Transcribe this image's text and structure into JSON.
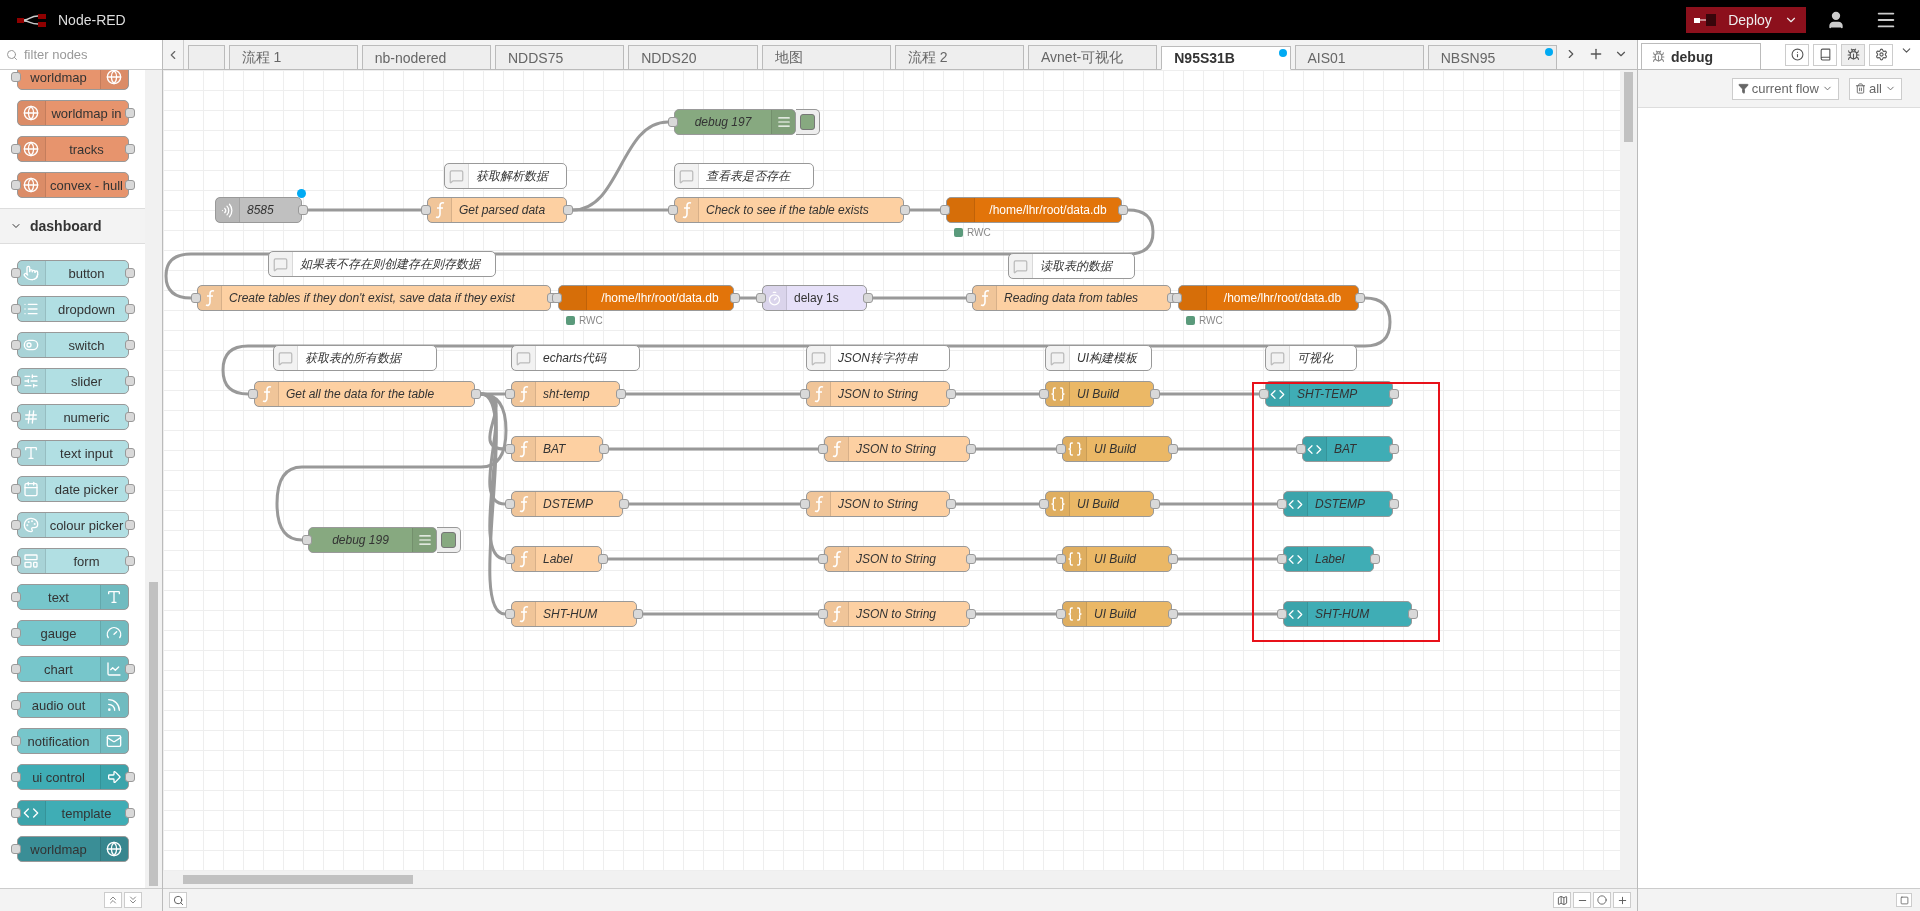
{
  "header": {
    "title": "Node-RED",
    "deploy": "Deploy"
  },
  "palette": {
    "filter_placeholder": "filter nodes",
    "nodes": [
      {
        "label": "worldmap",
        "kind": "output",
        "color": "#e7946d"
      },
      {
        "label": "worldmap in",
        "kind": "input",
        "color": "#e7946d"
      },
      {
        "label": "tracks",
        "kind": "function",
        "color": "#e7946d"
      },
      {
        "label": "convex - hull",
        "kind": "function",
        "color": "#e7946d"
      }
    ],
    "category": {
      "label": "dashboard",
      "expanded": true
    },
    "dashboard_nodes": [
      {
        "label": "button",
        "kind": "function",
        "color": "#b1dfe3"
      },
      {
        "label": "dropdown",
        "kind": "function",
        "color": "#b1dfe3"
      },
      {
        "label": "switch",
        "kind": "function",
        "color": "#b1dfe3"
      },
      {
        "label": "slider",
        "kind": "function",
        "color": "#b1dfe3"
      },
      {
        "label": "numeric",
        "kind": "function",
        "color": "#b1dfe3"
      },
      {
        "label": "text input",
        "kind": "function",
        "color": "#b1dfe3"
      },
      {
        "label": "date picker",
        "kind": "function",
        "color": "#b1dfe3"
      },
      {
        "label": "colour picker",
        "kind": "function",
        "color": "#b1dfe3"
      },
      {
        "label": "form",
        "kind": "function",
        "color": "#b1dfe3"
      },
      {
        "label": "text",
        "kind": "output",
        "color": "#77c6cb"
      },
      {
        "label": "gauge",
        "kind": "output",
        "color": "#77c6cb"
      },
      {
        "label": "chart",
        "kind": "through",
        "color": "#77c6cb"
      },
      {
        "label": "audio out",
        "kind": "output",
        "color": "#77c6cb"
      },
      {
        "label": "notification",
        "kind": "output",
        "color": "#77c6cb"
      },
      {
        "label": "ui control",
        "kind": "through",
        "color": "#3fadb5"
      },
      {
        "label": "template",
        "kind": "function",
        "color": "#3fadb5"
      },
      {
        "label": "worldmap",
        "kind": "output",
        "color": "#3a8e96"
      }
    ]
  },
  "tabs": [
    {
      "label": "流程 1",
      "selected": false,
      "changed": false
    },
    {
      "label": "nb-nodered",
      "selected": false,
      "changed": false
    },
    {
      "label": "NDDS75",
      "selected": false,
      "changed": false
    },
    {
      "label": "NDDS20",
      "selected": false,
      "changed": false
    },
    {
      "label": "地图",
      "selected": false,
      "changed": false
    },
    {
      "label": "流程 2",
      "selected": false,
      "changed": false
    },
    {
      "label": "Avnet-可视化",
      "selected": false,
      "changed": false
    },
    {
      "label": "N95S31B",
      "selected": true,
      "changed": true
    },
    {
      "label": "AIS01",
      "selected": false,
      "changed": false
    },
    {
      "label": "NBSN95",
      "selected": false,
      "changed": true
    }
  ],
  "canvas": {
    "nodes": [
      {
        "kind": "inject",
        "label": "8585",
        "changed": true
      },
      {
        "kind": "comment",
        "label": "获取解析数据",
        "changed": false
      },
      {
        "kind": "function",
        "label": "Get parsed data",
        "changed": false
      },
      {
        "kind": "debug",
        "label": "debug 197",
        "changed": false,
        "active": true
      },
      {
        "kind": "comment",
        "label": "查看表是否存在",
        "changed": false
      },
      {
        "kind": "function",
        "label": "Check to see if the table exists",
        "changed": false
      },
      {
        "kind": "sqlite",
        "label": "/home/lhr/root/data.db",
        "changed": false,
        "status": "RWC"
      },
      {
        "kind": "comment",
        "label": "如果表不存在则创建存在则存数据",
        "changed": false
      },
      {
        "kind": "function",
        "label": "Create tables if they don't exist, save data if they exist",
        "changed": false
      },
      {
        "kind": "sqlite",
        "label": "/home/lhr/root/data.db",
        "changed": false,
        "status": "RWC"
      },
      {
        "kind": "delay",
        "label": "delay 1s",
        "changed": false
      },
      {
        "kind": "comment",
        "label": "读取表的数据",
        "changed": false
      },
      {
        "kind": "function",
        "label": "Reading data from tables",
        "changed": false
      },
      {
        "kind": "sqlite",
        "label": "/home/lhr/root/data.db",
        "changed": false,
        "status": "RWC"
      },
      {
        "kind": "comment",
        "label": "获取表的所有数据",
        "changed": false
      },
      {
        "kind": "comment",
        "label": "echarts代码",
        "changed": false
      },
      {
        "kind": "comment",
        "label": "JSON转字符串",
        "changed": false
      },
      {
        "kind": "comment",
        "label": "UI构建模板",
        "changed": false
      },
      {
        "kind": "comment",
        "label": "可视化",
        "changed": false
      },
      {
        "kind": "function",
        "label": "Get all the data for the table",
        "changed": false
      },
      {
        "kind": "function",
        "label": "sht-temp",
        "changed": false
      },
      {
        "kind": "function",
        "label": "JSON to String",
        "changed": false
      },
      {
        "kind": "template",
        "label": "UI Build",
        "changed": false
      },
      {
        "kind": "ui-template",
        "label": "SHT-TEMP",
        "changed": false
      },
      {
        "kind": "function",
        "label": "BAT",
        "changed": false
      },
      {
        "kind": "function",
        "label": "JSON to String",
        "changed": false
      },
      {
        "kind": "template",
        "label": "UI Build",
        "changed": false
      },
      {
        "kind": "ui-template",
        "label": "BAT",
        "changed": false
      },
      {
        "kind": "function",
        "label": "DSTEMP",
        "changed": false
      },
      {
        "kind": "function",
        "label": "JSON to String",
        "changed": false
      },
      {
        "kind": "template",
        "label": "UI Build",
        "changed": false
      },
      {
        "kind": "ui-template",
        "label": "DSTEMP",
        "changed": false
      },
      {
        "kind": "function",
        "label": "Label",
        "changed": false
      },
      {
        "kind": "function",
        "label": "JSON to String",
        "changed": false
      },
      {
        "kind": "template",
        "label": "UI Build",
        "changed": false
      },
      {
        "kind": "ui-template",
        "label": "Label",
        "changed": false
      },
      {
        "kind": "function",
        "label": "SHT-HUM",
        "changed": false
      },
      {
        "kind": "function",
        "label": "JSON to String",
        "changed": false
      },
      {
        "kind": "template",
        "label": "UI Build",
        "changed": false
      },
      {
        "kind": "ui-template",
        "label": "SHT-HUM",
        "changed": false
      },
      {
        "kind": "debug",
        "label": "debug 199",
        "changed": false,
        "active": true
      }
    ]
  },
  "sidebar": {
    "tab": "debug",
    "filter": "current flow",
    "clear": "all"
  }
}
